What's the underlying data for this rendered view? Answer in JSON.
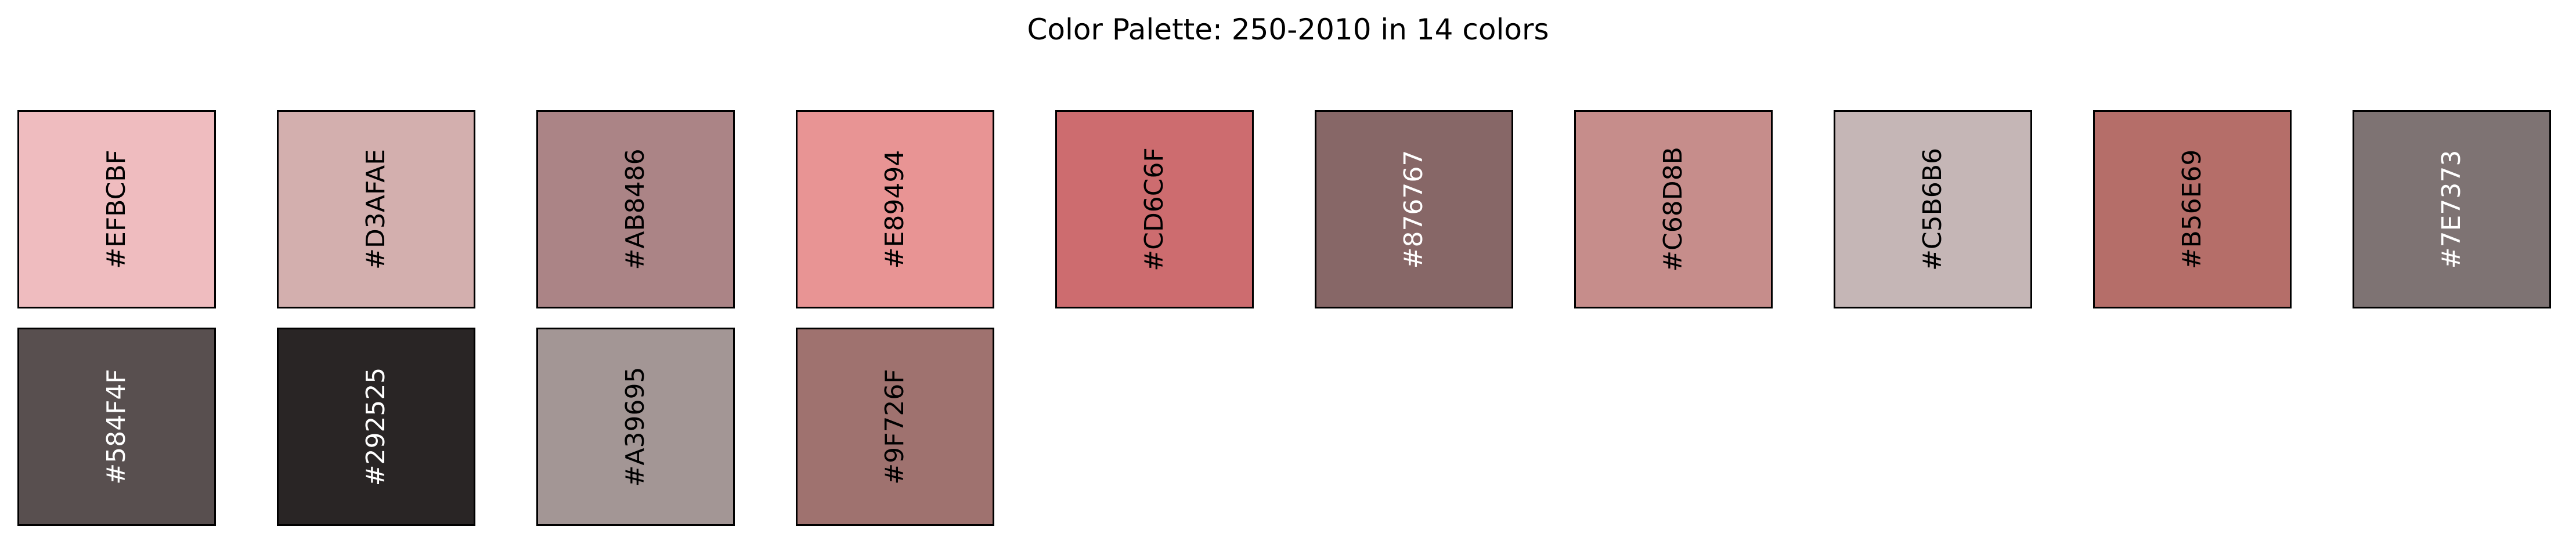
{
  "title": "Color Palette: 250-2010 in 14 colors",
  "chart_data": {
    "type": "table",
    "title": "Color Palette: 250-2010 in 14 colors",
    "swatches": [
      {
        "hex": "#EFBCBF",
        "label": "#EFBCBF",
        "text_color": "#000000"
      },
      {
        "hex": "#D3AFAE",
        "label": "#D3AFAE",
        "text_color": "#000000"
      },
      {
        "hex": "#AB8486",
        "label": "#AB8486",
        "text_color": "#000000"
      },
      {
        "hex": "#E89494",
        "label": "#E89494",
        "text_color": "#000000"
      },
      {
        "hex": "#CD6C6F",
        "label": "#CD6C6F",
        "text_color": "#000000"
      },
      {
        "hex": "#876767",
        "label": "#876767",
        "text_color": "#ffffff"
      },
      {
        "hex": "#C68D8B",
        "label": "#C68D8B",
        "text_color": "#000000"
      },
      {
        "hex": "#C5B6B6",
        "label": "#C5B6B6",
        "text_color": "#000000"
      },
      {
        "hex": "#B56E69",
        "label": "#B56E69",
        "text_color": "#000000"
      },
      {
        "hex": "#7E7373",
        "label": "#7E7373",
        "text_color": "#ffffff"
      },
      {
        "hex": "#584F4F",
        "label": "#584F4F",
        "text_color": "#ffffff"
      },
      {
        "hex": "#292525",
        "label": "#292525",
        "text_color": "#ffffff"
      },
      {
        "hex": "#A39695",
        "label": "#A39695",
        "text_color": "#000000"
      },
      {
        "hex": "#9F726F",
        "label": "#9F726F",
        "text_color": "#000000"
      }
    ]
  }
}
